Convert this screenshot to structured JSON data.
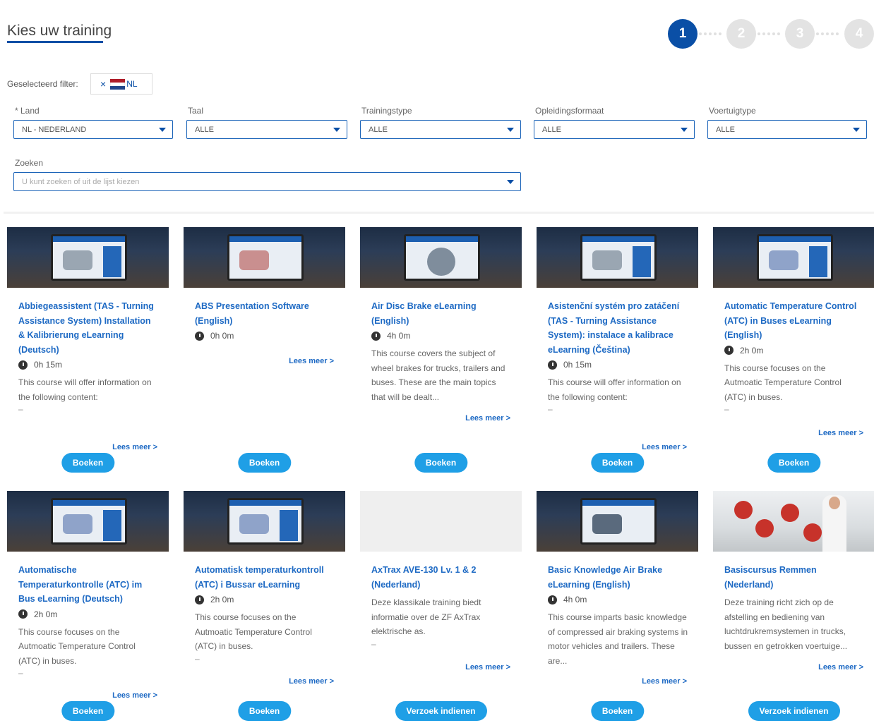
{
  "header": {
    "title": "Kies uw training"
  },
  "stepper": {
    "steps": [
      "1",
      "2",
      "3",
      "4"
    ],
    "active_step": 1
  },
  "filter": {
    "label": "Geselecteerd filter:",
    "chip_remove": "×",
    "chip_text": "NL",
    "flag_colors": [
      "#ae1c28",
      "#ffffff",
      "#21468b"
    ]
  },
  "fields": {
    "land": {
      "label": "* Land",
      "value": "NL - NEDERLAND"
    },
    "taal": {
      "label": "Taal",
      "value": "ALLE"
    },
    "trainingstype": {
      "label": "Trainingstype",
      "value": "ALLE"
    },
    "opleidingsformaat": {
      "label": "Opleidingsformaat",
      "value": "ALLE"
    },
    "voertuigtype": {
      "label": "Voertuigtype",
      "value": "ALLE"
    },
    "zoeken": {
      "label": "Zoeken",
      "placeholder": "U kunt zoeken of uit de lijst kiezen"
    }
  },
  "cards": [
    {
      "title": "Abbiegeassistent (TAS - Turning Assistance System) Installation & Kalibrierung eLearning (Deutsch)",
      "duration": "0h 15m",
      "description": "This course will offer information on the following content:",
      "dash": "–",
      "read_more": "Lees meer >",
      "button": "Boeken"
    },
    {
      "title": "ABS Presentation Software (English)",
      "duration": "0h 0m",
      "description": "",
      "dash": "",
      "read_more": "Lees meer >",
      "button": "Boeken"
    },
    {
      "title": "Air Disc Brake eLearning (English)",
      "duration": "4h 0m",
      "description": "This course covers the subject of wheel brakes for trucks, trailers and buses. These are the main topics that will be dealt...",
      "dash": "",
      "read_more": "Lees meer >",
      "button": "Boeken"
    },
    {
      "title": "Asistenční systém pro zatáčení (TAS - Turning Assistance System): instalace a kalibrace eLearning (Čeština)",
      "duration": "0h 15m",
      "description": "This course will offer information on the following content:",
      "dash": "–",
      "read_more": "Lees meer >",
      "button": "Boeken"
    },
    {
      "title": "Automatic Temperature Control (ATC) in Buses eLearning (English)",
      "duration": "2h 0m",
      "description": "This course focuses on the Autmoatic Temperature Control (ATC) in buses.",
      "dash": "–",
      "read_more": "Lees meer >",
      "button": "Boeken"
    },
    {
      "title": "Automatische Temperaturkontrolle (ATC) im Bus eLearning (Deutsch)",
      "duration": "2h 0m",
      "description": "This course focuses on the Autmoatic Temperature Control (ATC) in buses.",
      "dash": "–",
      "read_more": "Lees meer >",
      "button": "Boeken"
    },
    {
      "title": "Automatisk temperaturkontroll (ATC) i Bussar eLearning",
      "duration": "2h 0m",
      "description": "This course focuses on the Autmoatic Temperature Control (ATC) in buses.",
      "dash": "–",
      "read_more": "Lees meer >",
      "button": "Boeken"
    },
    {
      "title": "AxTrax AVE-130 Lv. 1 & 2 (Nederland)",
      "duration": "",
      "description": "Deze klassikale training biedt informatie over de ZF AxTrax elektrische as.",
      "dash": "–",
      "read_more": "Lees meer >",
      "button": "Verzoek indienen"
    },
    {
      "title": "Basic Knowledge Air Brake eLearning (English)",
      "duration": "4h 0m",
      "description": "This course imparts basic knowledge of compressed air braking systems in motor vehicles and trailers. These are...",
      "dash": "",
      "read_more": "Lees meer >",
      "button": "Boeken"
    },
    {
      "title": "Basiscursus Remmen (Nederland)",
      "duration": "",
      "description": "Deze training richt zich op de afstelling en bediening van luchtdrukremsystemen in trucks, bussen en getrokken voertuige...",
      "dash": "",
      "read_more": "Lees meer >",
      "button": "Verzoek indienen"
    }
  ]
}
